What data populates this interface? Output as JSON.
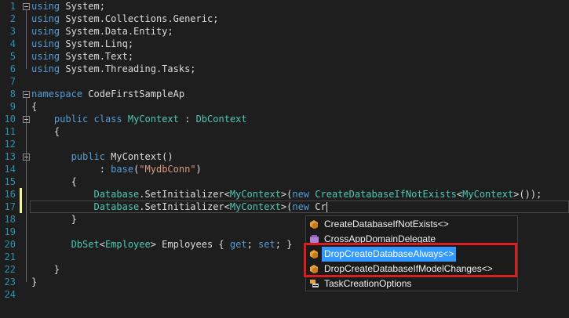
{
  "editor": {
    "line_numbers": [
      "1",
      "2",
      "3",
      "4",
      "5",
      "6",
      "7",
      "8",
      "9",
      "10",
      "11",
      "12",
      "13",
      "14",
      "15",
      "16",
      "17",
      "18",
      "19",
      "20",
      "21",
      "22",
      "23",
      "24"
    ],
    "lines": [
      [
        {
          "k": "kw",
          "t": "using"
        },
        {
          "k": "pl",
          "t": " System;"
        }
      ],
      [
        {
          "k": "kw",
          "t": "using"
        },
        {
          "k": "pl",
          "t": " System.Collections.Generic;"
        }
      ],
      [
        {
          "k": "kw",
          "t": "using"
        },
        {
          "k": "pl",
          "t": " System.Data.Entity;"
        }
      ],
      [
        {
          "k": "kw",
          "t": "using"
        },
        {
          "k": "pl",
          "t": " System.Linq;"
        }
      ],
      [
        {
          "k": "kw",
          "t": "using"
        },
        {
          "k": "pl",
          "t": " System.Text;"
        }
      ],
      [
        {
          "k": "kw",
          "t": "using"
        },
        {
          "k": "pl",
          "t": " System.Threading.Tasks;"
        }
      ],
      [],
      [
        {
          "k": "kw",
          "t": "namespace"
        },
        {
          "k": "pl",
          "t": " CodeFirstSampleAp"
        }
      ],
      [
        {
          "k": "pl",
          "t": "{"
        }
      ],
      [
        {
          "k": "pl",
          "t": "    "
        },
        {
          "k": "kw",
          "t": "public"
        },
        {
          "k": "pl",
          "t": " "
        },
        {
          "k": "kw",
          "t": "class"
        },
        {
          "k": "pl",
          "t": " "
        },
        {
          "k": "ty",
          "t": "MyContext"
        },
        {
          "k": "pl",
          "t": " : "
        },
        {
          "k": "ty",
          "t": "DbContext"
        }
      ],
      [
        {
          "k": "pl",
          "t": "    {"
        }
      ],
      [],
      [
        {
          "k": "pl",
          "t": "       "
        },
        {
          "k": "kw",
          "t": "public"
        },
        {
          "k": "pl",
          "t": " MyContext()"
        }
      ],
      [
        {
          "k": "pl",
          "t": "            : "
        },
        {
          "k": "kw",
          "t": "base"
        },
        {
          "k": "pl",
          "t": "("
        },
        {
          "k": "st",
          "t": "\"MydbConn\""
        },
        {
          "k": "pl",
          "t": ")"
        }
      ],
      [
        {
          "k": "pl",
          "t": "       {"
        }
      ],
      [
        {
          "k": "pl",
          "t": "           "
        },
        {
          "k": "ty",
          "t": "Database"
        },
        {
          "k": "pl",
          "t": ".SetInitializer<"
        },
        {
          "k": "ty",
          "t": "MyContext"
        },
        {
          "k": "pl",
          "t": ">("
        },
        {
          "k": "kw",
          "t": "new"
        },
        {
          "k": "pl",
          "t": " "
        },
        {
          "k": "ty",
          "t": "CreateDatabaseIfNotExists"
        },
        {
          "k": "pl",
          "t": "<"
        },
        {
          "k": "ty",
          "t": "MyContext"
        },
        {
          "k": "pl",
          "t": ">());"
        }
      ],
      [
        {
          "k": "pl",
          "t": "           "
        },
        {
          "k": "ty",
          "t": "Database"
        },
        {
          "k": "pl",
          "t": ".SetInitializer<"
        },
        {
          "k": "ty",
          "t": "MyContext"
        },
        {
          "k": "pl",
          "t": ">("
        },
        {
          "k": "kw",
          "t": "new"
        },
        {
          "k": "pl",
          "t": " Cr"
        }
      ],
      [
        {
          "k": "pl",
          "t": "       }"
        }
      ],
      [],
      [
        {
          "k": "pl",
          "t": "       "
        },
        {
          "k": "ty",
          "t": "DbSet"
        },
        {
          "k": "pl",
          "t": "<"
        },
        {
          "k": "ty",
          "t": "Employee"
        },
        {
          "k": "pl",
          "t": "> Employees { "
        },
        {
          "k": "kw",
          "t": "get"
        },
        {
          "k": "pl",
          "t": "; "
        },
        {
          "k": "kw",
          "t": "set"
        },
        {
          "k": "pl",
          "t": "; }"
        }
      ],
      [],
      [
        {
          "k": "pl",
          "t": "    }"
        }
      ],
      [
        {
          "k": "pl",
          "t": "}"
        }
      ],
      []
    ]
  },
  "intellisense": {
    "items": [
      {
        "label": "CreateDatabaseIfNotExists<>",
        "icon": "class-icon",
        "selected": false
      },
      {
        "label": "CrossAppDomainDelegate",
        "icon": "delegate-icon",
        "selected": false
      },
      {
        "label": "DropCreateDatabaseAlways<>",
        "icon": "class-icon",
        "selected": true
      },
      {
        "label": "DropCreateDatabaseIfModelChanges<>",
        "icon": "class-icon",
        "selected": false
      },
      {
        "label": "TaskCreationOptions",
        "icon": "enum-icon",
        "selected": false
      }
    ],
    "highlight_color": "#d81e1e",
    "selection_color": "#3399ff"
  }
}
